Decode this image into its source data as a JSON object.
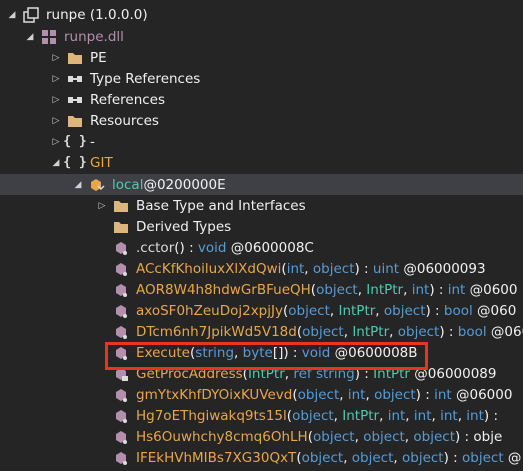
{
  "tree": {
    "root": "runpe (1.0.0.0)",
    "dll": "runpe.dll",
    "pe": "PE",
    "type_refs": "Type References",
    "refs": "References",
    "resources": "Resources",
    "dash_ns": "-",
    "git_ns": "GIT",
    "local_class": "local",
    "local_token": " @0200000E",
    "base_types": "Base Type and Interfaces",
    "derived_types": "Derived Types",
    "methods": [
      {
        "name": ".cctor",
        "sig": "() : void @0600008C"
      },
      {
        "name": "ACcKfKhoiluxXlXdQwi",
        "sig": "(int, object) : uint @06000093"
      },
      {
        "name": "AOR8W4h8hdwGrBFueQH",
        "sig": "(object, IntPtr, int) : int @0600"
      },
      {
        "name": "axoSF0hZeuDoj2xpjJy",
        "sig": "(object, IntPtr, object) : bool @060"
      },
      {
        "name": "DTcm6nh7JpikWd5V18d",
        "sig": "(object, IntPtr, object) : bool @0600"
      },
      {
        "name": "Execute",
        "sig": "(string, byte[]) : void @0600008B"
      },
      {
        "name": "GetProcAddress",
        "sig": "(IntPtr, ref string) : IntPtr @06000089"
      },
      {
        "name": "gmYtxKhfDYOixKUVevd",
        "sig": "(object, int, object) : int @06000"
      },
      {
        "name": "Hg7oEThgiwakq9ts15l",
        "sig": "(object, IntPtr, int, int, int, int) :"
      },
      {
        "name": "Hs6Ouwhchy8cmq6OhLH",
        "sig": "(object, object, object) : obje"
      },
      {
        "name": "IFEkHVhMIBs7XG30QxT",
        "sig": "(object, object, object) : object @"
      }
    ]
  },
  "colors": {
    "background": "#252526",
    "selected_row": "#3f3f46",
    "highlight_box": "#e8351e",
    "method_name": "#e8a64c",
    "type_keyword": "#569cd6",
    "intptr_type": "#4ec9b0",
    "assembly_purple": "#b48ead"
  }
}
